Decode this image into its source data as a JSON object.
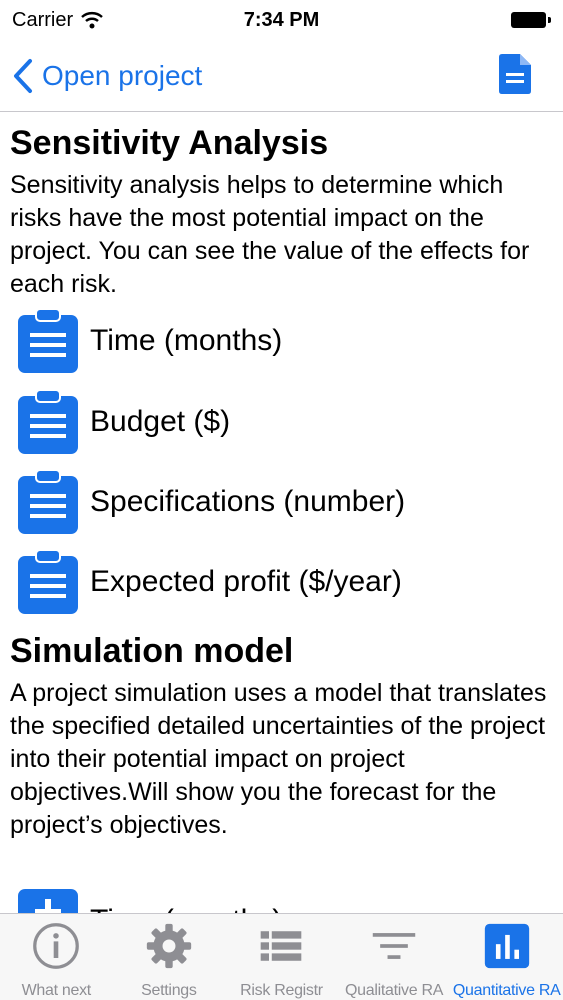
{
  "status_bar": {
    "carrier": "Carrier",
    "time": "7:34 PM"
  },
  "nav": {
    "back_label": "Open project",
    "right_icon": "document-icon"
  },
  "sensitivity": {
    "title": "Sensitivity Analysis",
    "description": "Sensitivity analysis helps to determine which risks have the most potential impact on the project. You can see the value of the effects for each risk.",
    "items": [
      {
        "label": "Time (months)",
        "icon": "clipboard-icon"
      },
      {
        "label": "Budget ($)",
        "icon": "clipboard-icon"
      },
      {
        "label": "Specifications (number)",
        "icon": "clipboard-icon"
      },
      {
        "label": "Expected profit ($/year)",
        "icon": "clipboard-icon"
      }
    ]
  },
  "simulation": {
    "title": "Simulation model",
    "description": "A project simulation uses a model that translates the specified detailed uncertainties of the project into their potential impact on project objectives.Will show you the forecast for the project’s objectives.",
    "items": [
      {
        "label": "Time (months)",
        "icon": "plus-icon"
      }
    ]
  },
  "tabs": [
    {
      "label": "What next",
      "icon": "info-icon",
      "active": false
    },
    {
      "label": "Settings",
      "icon": "gear-icon",
      "active": false
    },
    {
      "label": "Risk Registr",
      "icon": "list-icon",
      "active": false
    },
    {
      "label": "Qualitative RA",
      "icon": "filter-icon",
      "active": false
    },
    {
      "label": "Quantitative RA",
      "icon": "bar-chart-icon",
      "active": true
    }
  ],
  "colors": {
    "accent": "#1a73e8",
    "tab_inactive": "#8e8e93"
  }
}
